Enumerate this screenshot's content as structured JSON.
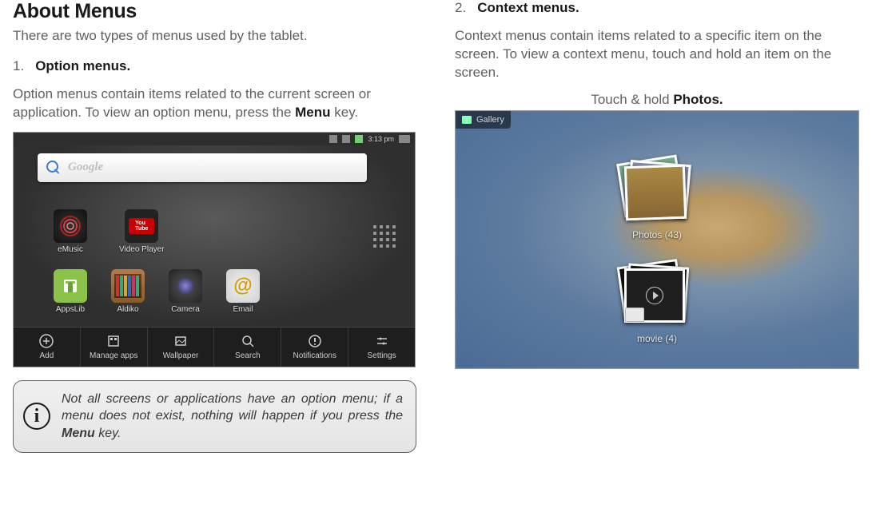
{
  "left": {
    "heading": "About Menus",
    "intro": "There are two types of menus used by the tablet.",
    "item1_num": "1.",
    "item1_label": "Option menus.",
    "para1_a": "Option menus contain items related to the current screen or application. To view an option menu, press the ",
    "para1_bold": "Menu",
    "para1_b": " key.",
    "info_text_a": "Not all screens or applications have an option menu; if a menu does not exist, nothing will happen if you press the ",
    "info_text_bold": "Menu",
    "info_text_b": " key."
  },
  "shot1": {
    "time": "3:13 pm",
    "search_placeholder": "Google",
    "apps_row1": [
      {
        "label": "eMusic"
      },
      {
        "label": "Video Player"
      }
    ],
    "apps_row2": [
      {
        "label": "AppsLib"
      },
      {
        "label": "Aldiko"
      },
      {
        "label": "Camera"
      },
      {
        "label": "Email"
      }
    ],
    "menu": [
      "Add",
      "Manage apps",
      "Wallpaper",
      "Search",
      "Notifications",
      "Settings"
    ]
  },
  "right": {
    "item2_num": "2.",
    "item2_label": "Context menus.",
    "para2": "Context menus contain items related to a specific item on the screen. To view a context menu, touch and hold an item on the screen.",
    "caption_a": "Touch & hold ",
    "caption_bold": "Photos."
  },
  "shot2": {
    "header": "Gallery",
    "albums": [
      {
        "name": "Photos",
        "count": 43,
        "label": "Photos  (43)"
      },
      {
        "name": "movie",
        "count": 4,
        "label": "movie  (4)"
      }
    ]
  }
}
